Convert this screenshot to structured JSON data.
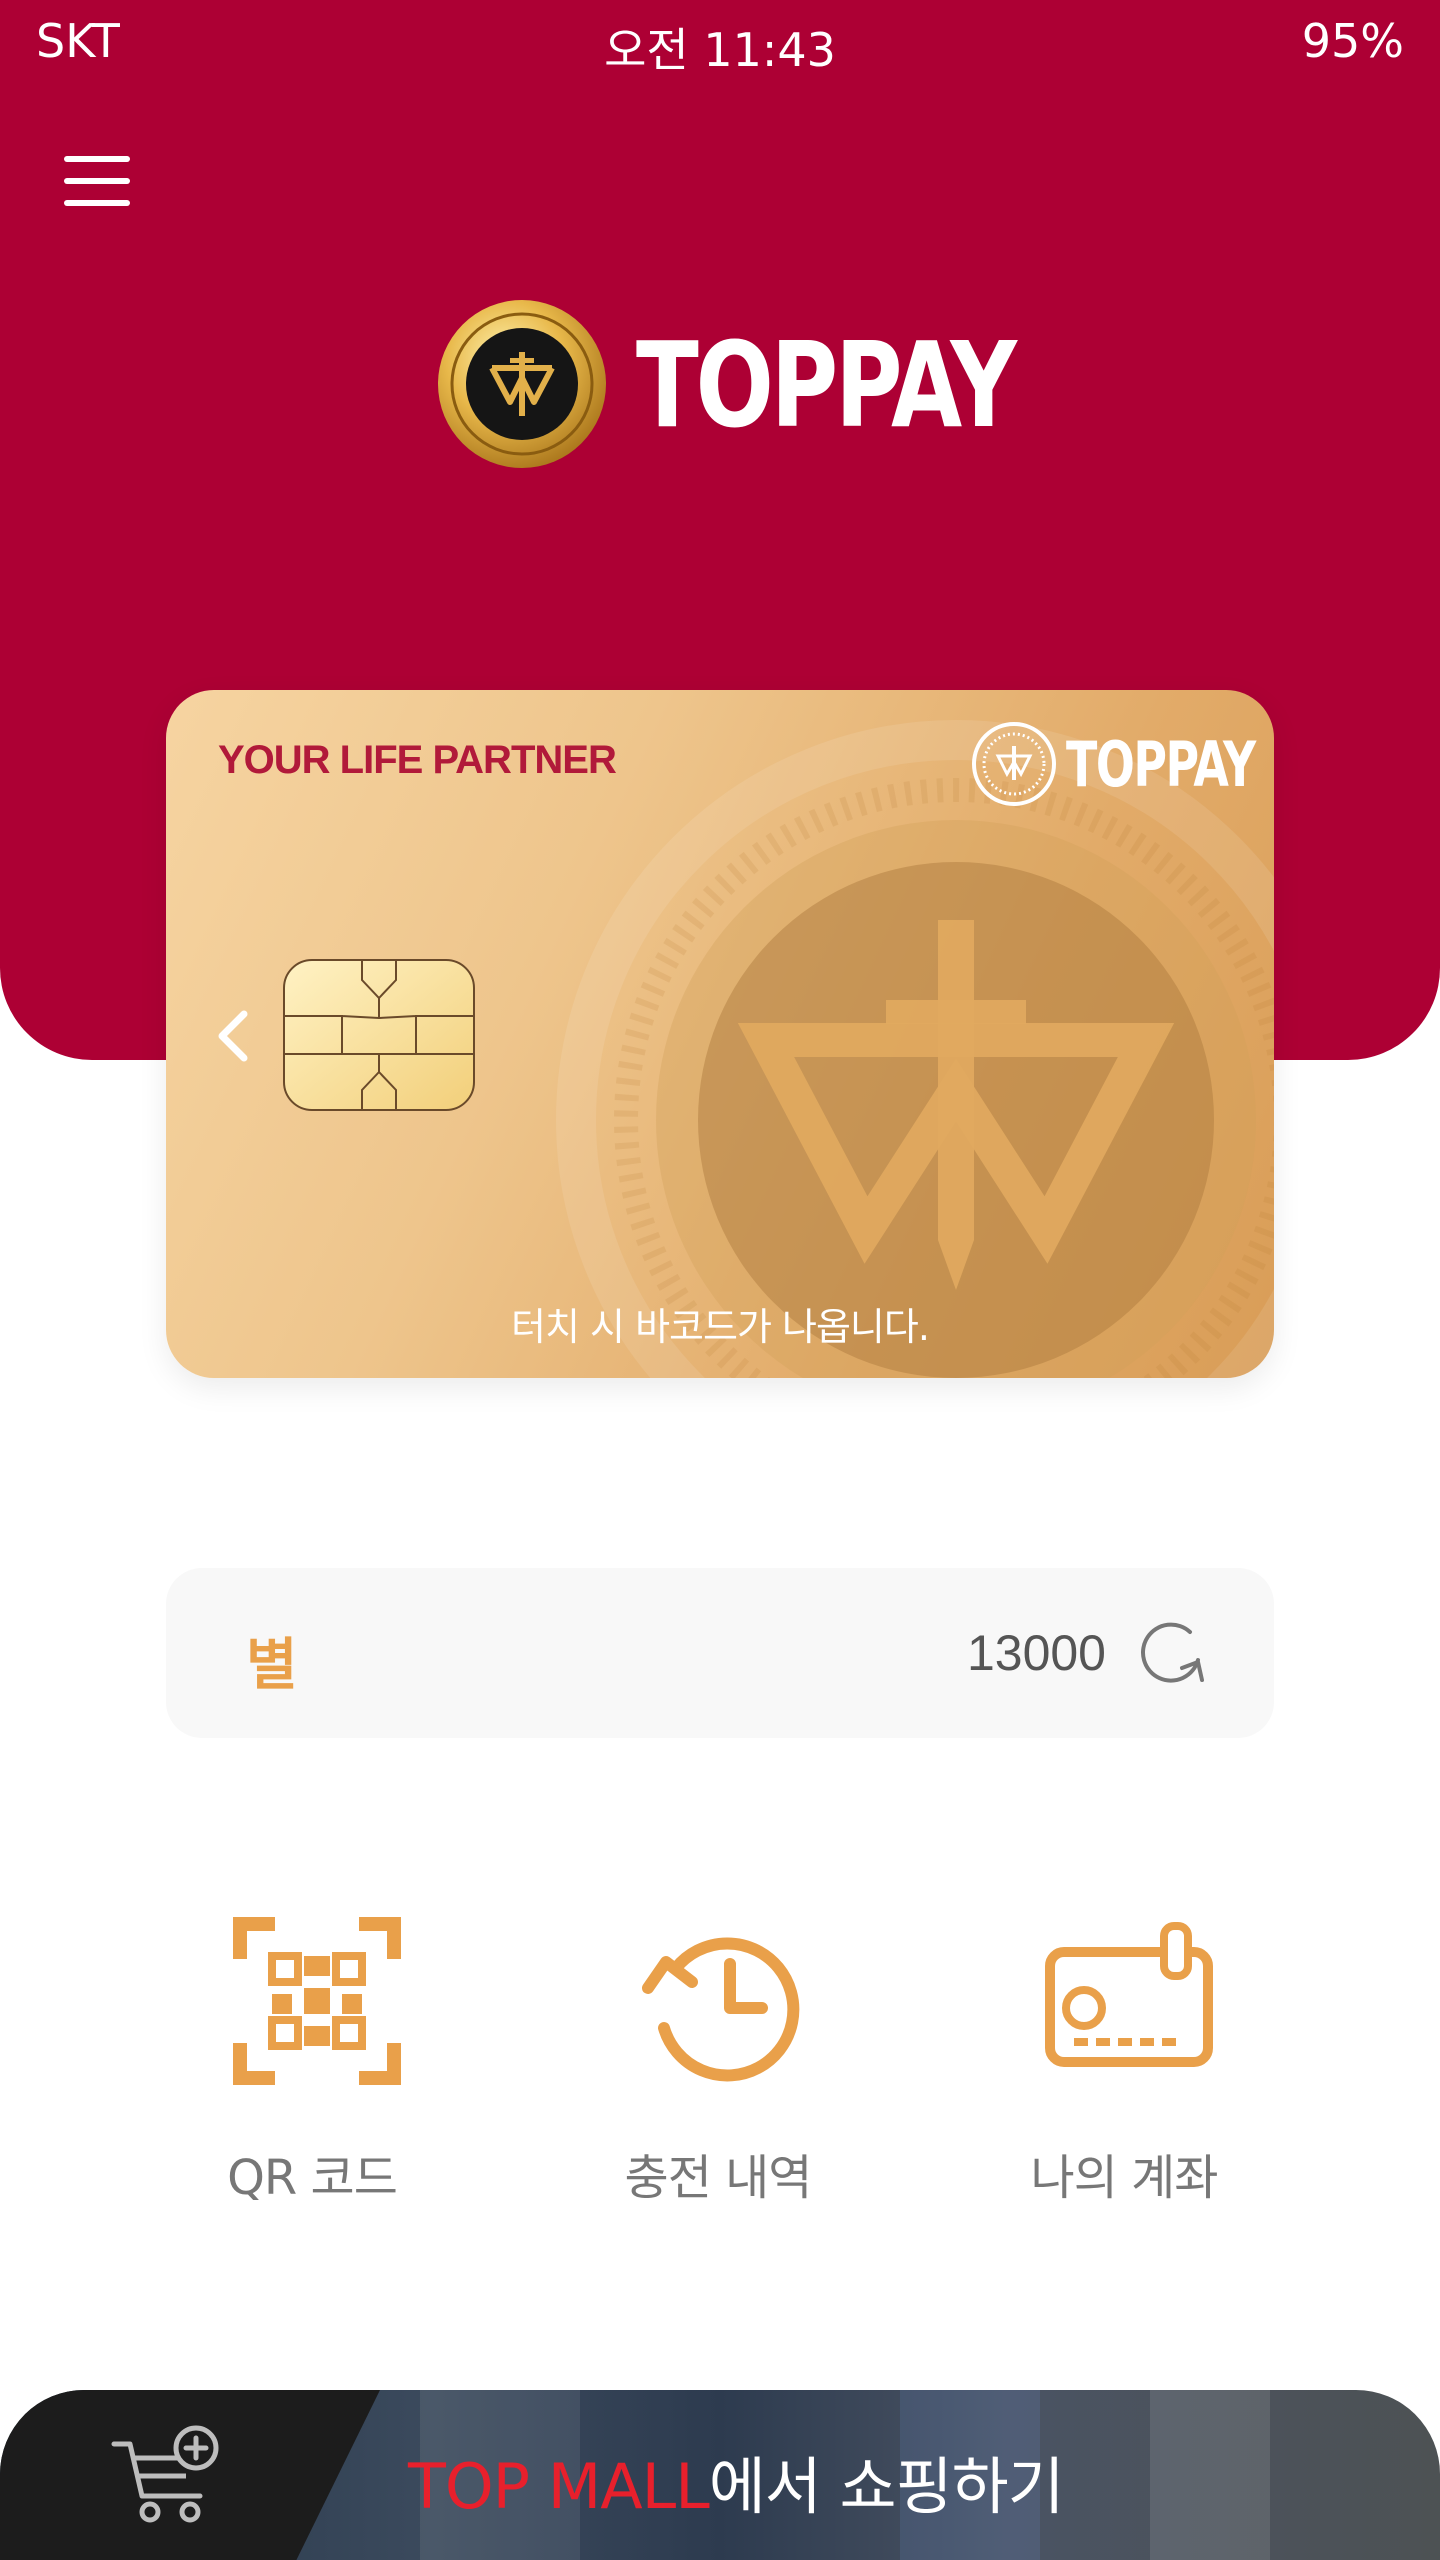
{
  "status_bar": {
    "carrier": "SKT",
    "time": "오전 11:43",
    "battery": "95%"
  },
  "header": {
    "brand_name": "TOPPAY"
  },
  "card": {
    "tagline": "YOUR LIFE PARTNER",
    "brand_name": "TOPPAY",
    "hint": "터치 시 바코드가 나옵니다."
  },
  "balance": {
    "label": "별",
    "value": "13000"
  },
  "actions": [
    {
      "label": "QR 코드",
      "icon": "qr-code-icon"
    },
    {
      "label": "충전 내역",
      "icon": "history-icon"
    },
    {
      "label": "나의 계좌",
      "icon": "account-card-icon"
    }
  ],
  "mall": {
    "accent": "TOP MALL",
    "rest": "에서 쇼핑하기",
    "icon": "cart-plus-icon"
  },
  "colors": {
    "brand": "#ad0034",
    "accent": "#e9a04a",
    "mall_accent": "#e8202c"
  }
}
